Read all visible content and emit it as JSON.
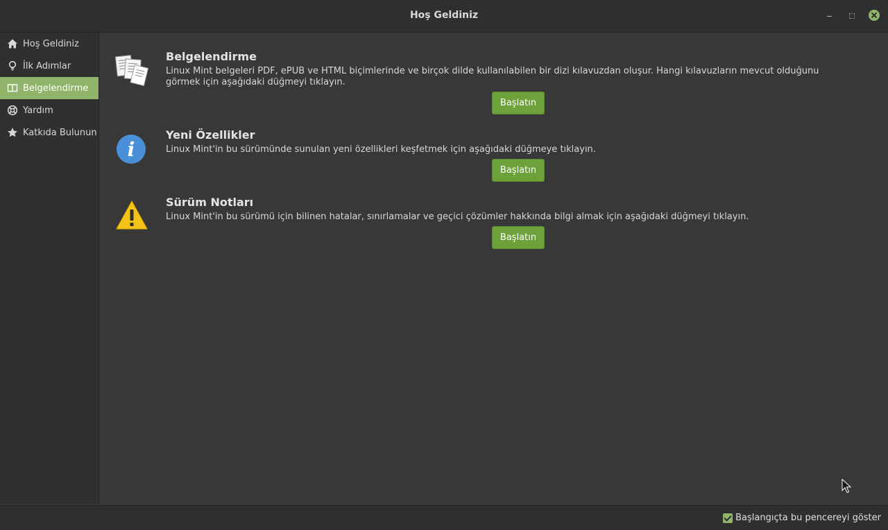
{
  "window": {
    "title": "Hoş Geldiniz"
  },
  "sidebar": {
    "items": [
      {
        "label": "Hoş Geldiniz",
        "icon": "home-icon",
        "active": false
      },
      {
        "label": "İlk Adımlar",
        "icon": "lightbulb-icon",
        "active": false
      },
      {
        "label": "Belgelendirme",
        "icon": "book-icon",
        "active": true
      },
      {
        "label": "Yardım",
        "icon": "lifebuoy-icon",
        "active": false
      },
      {
        "label": "Katkıda Bulunun",
        "icon": "star-icon",
        "active": false
      }
    ]
  },
  "sections": [
    {
      "title": "Belgelendirme",
      "icon": "documents-icon",
      "description": "Linux Mint belgeleri PDF, ePUB ve HTML biçimlerinde ve birçok dilde kullanılabilen bir dizi kılavuzdan oluşur. Hangi kılavuzların mevcut olduğunu görmek için aşağıdaki düğmeyi tıklayın.",
      "button": "Başlatın"
    },
    {
      "title": "Yeni Özellikler",
      "icon": "info-icon",
      "description": "Linux Mint'in bu sürümünde sunulan yeni özellikleri keşfetmek için aşağıdaki düğmeye tıklayın.",
      "button": "Başlatın"
    },
    {
      "title": "Sürüm Notları",
      "icon": "warning-icon",
      "description": "Linux Mint'in bu sürümü için bilinen hatalar, sınırlamalar ve geçici çözümler hakkında bilgi almak için aşağıdaki düğmeyi tıklayın.",
      "button": "Başlatın"
    }
  ],
  "footer": {
    "autostart_label": "Başlangıçta bu pencereyi göster",
    "autostart_checked": true
  },
  "colors": {
    "accent": "#8fb46a",
    "button": "#6da13a",
    "background": "#383838",
    "sidebar": "#303030"
  }
}
